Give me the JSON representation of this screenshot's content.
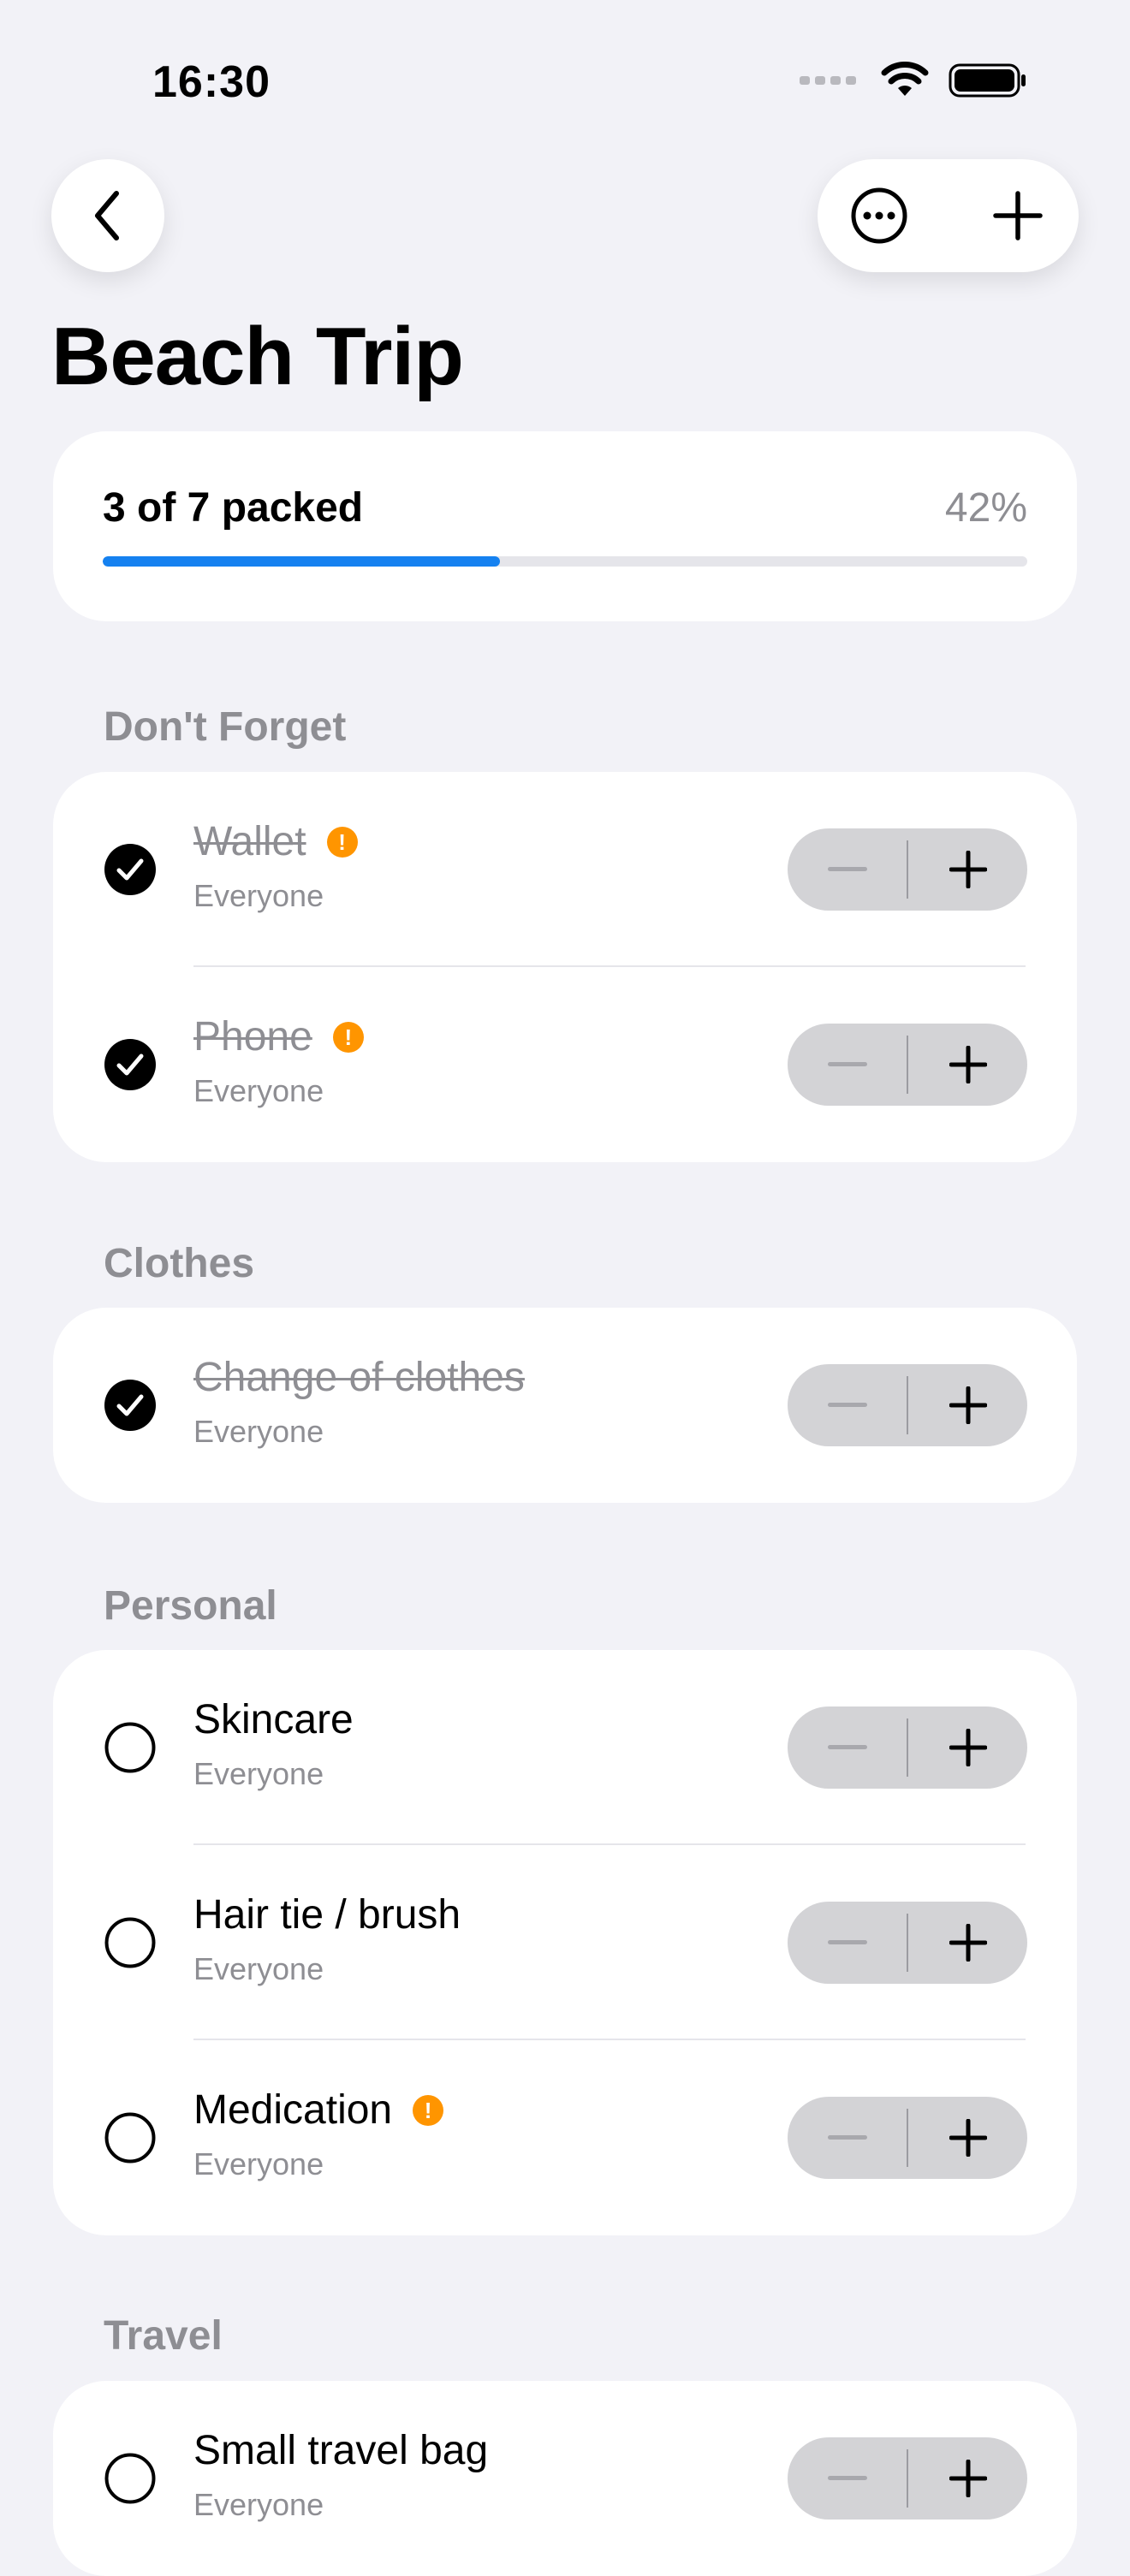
{
  "status_bar": {
    "time": "16:30"
  },
  "nav": {
    "back_icon": "chevron-left-icon",
    "more_icon": "ellipsis-circle-icon",
    "add_icon": "plus-icon"
  },
  "page": {
    "title": "Beach Trip"
  },
  "progress": {
    "label": "3 of 7 packed",
    "percent_text": "42%",
    "fraction": 0.43,
    "color": "#1581f0"
  },
  "colors": {
    "alert": "#ff9500",
    "secondary_text": "#8e8e93"
  },
  "sections": [
    {
      "title": "Don't Forget",
      "items": [
        {
          "name": "Wallet",
          "assignee": "Everyone",
          "packed": true,
          "important": true
        },
        {
          "name": "Phone",
          "assignee": "Everyone",
          "packed": true,
          "important": true
        }
      ]
    },
    {
      "title": "Clothes",
      "items": [
        {
          "name": "Change of clothes",
          "assignee": "Everyone",
          "packed": true,
          "important": false
        }
      ]
    },
    {
      "title": "Personal",
      "items": [
        {
          "name": "Skincare",
          "assignee": "Everyone",
          "packed": false,
          "important": false
        },
        {
          "name": "Hair tie / brush",
          "assignee": "Everyone",
          "packed": false,
          "important": false
        },
        {
          "name": "Medication",
          "assignee": "Everyone",
          "packed": false,
          "important": true
        }
      ]
    },
    {
      "title": "Travel",
      "items": [
        {
          "name": "Small travel bag",
          "assignee": "Everyone",
          "packed": false,
          "important": false
        }
      ]
    }
  ]
}
